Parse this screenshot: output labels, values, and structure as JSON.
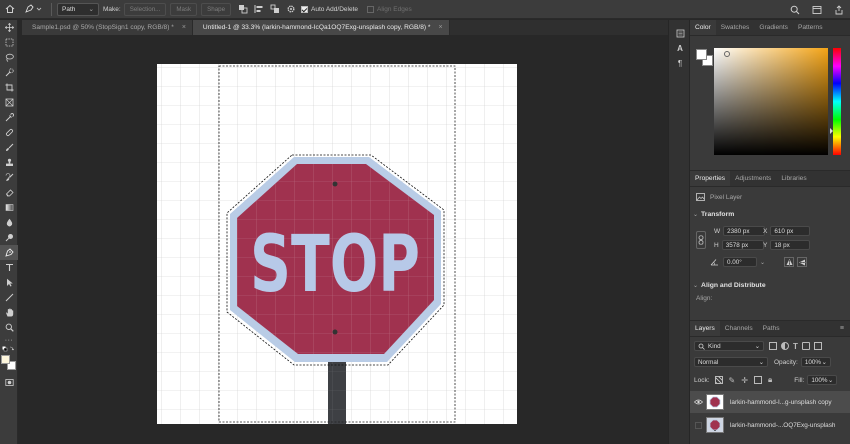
{
  "options_bar": {
    "mode_value": "Path",
    "make_label": "Make:",
    "selection_btn": "Selection...",
    "mask_btn": "Mask",
    "shape_btn": "Shape",
    "auto_add_label": "Auto Add/Delete",
    "align_edges_label": "Align Edges"
  },
  "tabs": [
    {
      "label": "Sample1.psd @ 50% (StopSign1 copy, RGB/8) *",
      "close": "×"
    },
    {
      "label": "Untitled-1 @ 33.3% (larkin-hammond-IcQa1OQ7Exg-unsplash copy, RGB/8) *",
      "close": "×"
    }
  ],
  "canvas": {
    "sign_text": "STOP",
    "sign_color": "#a0324f",
    "sign_border": "#b9cce6",
    "letter_color": "#b7c9e8"
  },
  "color_panel": {
    "tabs": [
      "Color",
      "Swatches",
      "Gradients",
      "Patterns"
    ],
    "menu": "≡"
  },
  "properties_panel": {
    "tabs": [
      "Properties",
      "Adjustments",
      "Libraries"
    ],
    "menu": "≡",
    "layer_type": "Pixel Layer",
    "transform_title": "Transform",
    "w_label": "W",
    "w_value": "2380 px",
    "h_label": "H",
    "h_value": "3578 px",
    "x_label": "X",
    "x_value": "610 px",
    "y_label": "Y",
    "y_value": "18 px",
    "angle_value": "0.00°",
    "align_title": "Align and Distribute",
    "align_label": "Align:"
  },
  "layers_panel": {
    "tabs": [
      "Layers",
      "Channels",
      "Paths"
    ],
    "menu": "≡",
    "filter_value": "Kind",
    "blend_mode": "Normal",
    "opacity_label": "Opacity:",
    "opacity_value": "100%",
    "lock_label": "Lock:",
    "fill_label": "Fill:",
    "fill_value": "100%",
    "layers": [
      {
        "name": "larkin-hammond-I...g-unsplash copy",
        "selected": true
      },
      {
        "name": "larkin-hammond-...OQ7Exg-unsplash",
        "selected": false
      }
    ]
  }
}
